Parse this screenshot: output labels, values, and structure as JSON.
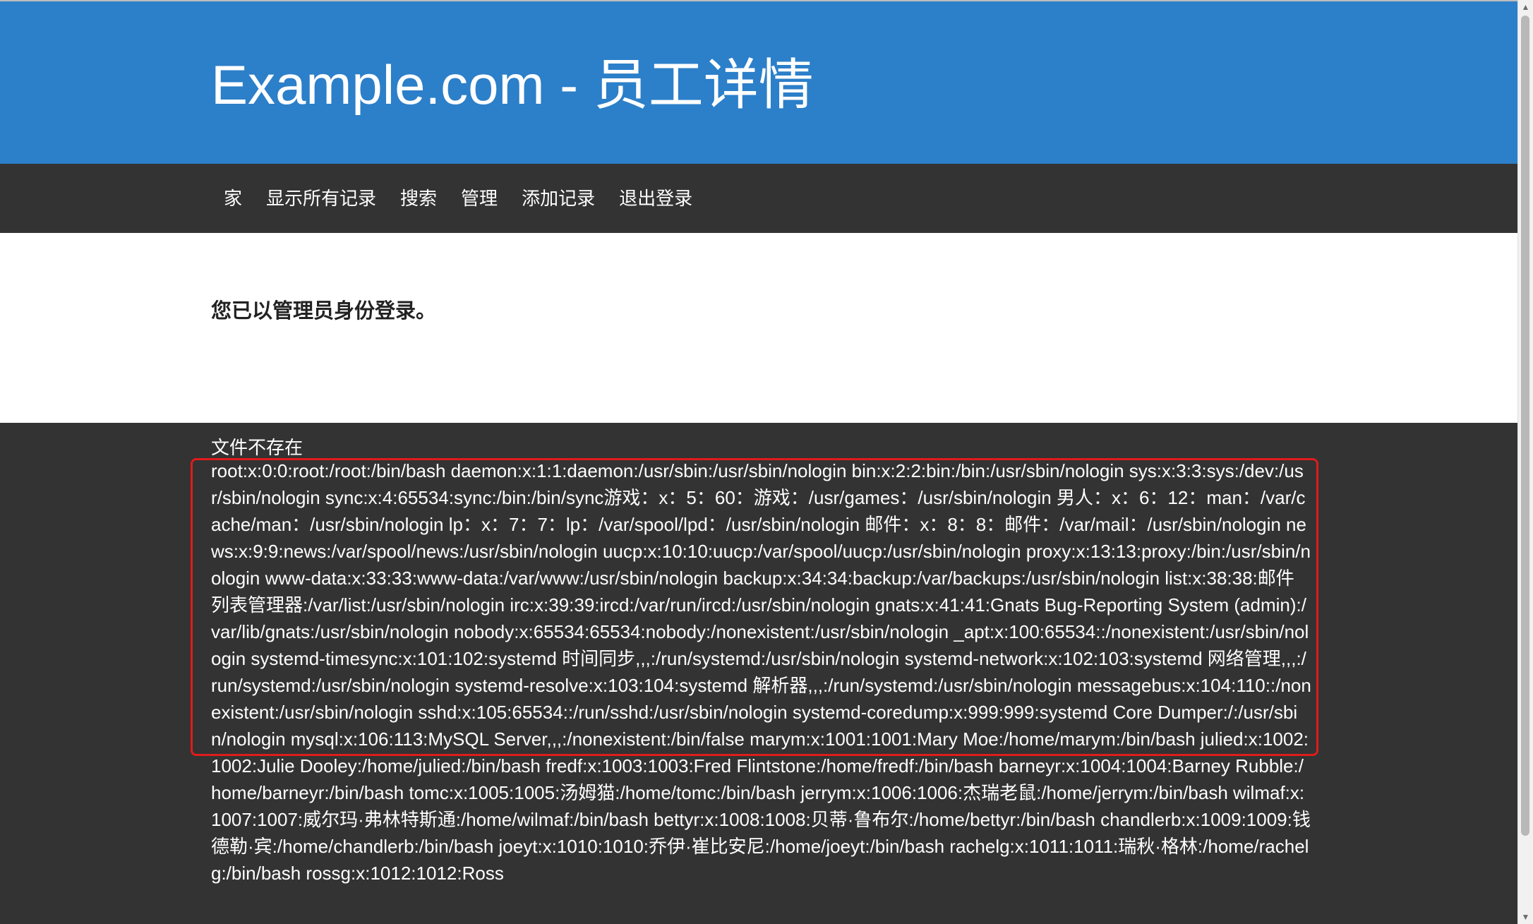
{
  "header": {
    "title": "Example.com - 员工详情"
  },
  "nav": {
    "items": [
      {
        "label": "家"
      },
      {
        "label": "显示所有记录"
      },
      {
        "label": "搜索"
      },
      {
        "label": "管理"
      },
      {
        "label": "添加记录"
      },
      {
        "label": "退出登录"
      }
    ]
  },
  "main": {
    "status_message": "您已以管理员身份登录。"
  },
  "footer": {
    "file_missing": "文件不存在",
    "file_output": "root:x:0:0:root:/root:/bin/bash daemon:x:1:1:daemon:/usr/sbin:/usr/sbin/nologin bin:x:2:2:bin:/bin:/usr/sbin/nologin sys:x:3:3:sys:/dev:/usr/sbin/nologin sync:x:4:65534:sync:/bin:/bin/sync游戏：x：5：60：游戏：/usr/games：/usr/sbin/nologin 男人：x：6：12：man：/var/cache/man：/usr/sbin/nologin lp：x：7：7：lp：/var/spool/lpd：/usr/sbin/nologin 邮件：x：8：8：邮件：/var/mail：/usr/sbin/nologin news:x:9:9:news:/var/spool/news:/usr/sbin/nologin uucp:x:10:10:uucp:/var/spool/uucp:/usr/sbin/nologin proxy:x:13:13:proxy:/bin:/usr/sbin/nologin www-data:x:33:33:www-data:/var/www:/usr/sbin/nologin backup:x:34:34:backup:/var/backups:/usr/sbin/nologin list:x:38:38:邮件列表管理器:/var/list:/usr/sbin/nologin irc:x:39:39:ircd:/var/run/ircd:/usr/sbin/nologin gnats:x:41:41:Gnats Bug-Reporting System (admin):/var/lib/gnats:/usr/sbin/nologin nobody:x:65534:65534:nobody:/nonexistent:/usr/sbin/nologin _apt:x:100:65534::/nonexistent:/usr/sbin/nologin systemd-timesync:x:101:102:systemd 时间同步,,,:/run/systemd:/usr/sbin/nologin systemd-network:x:102:103:systemd 网络管理,,,:/run/systemd:/usr/sbin/nologin systemd-resolve:x:103:104:systemd 解析器,,,:/run/systemd:/usr/sbin/nologin messagebus:x:104:110::/nonexistent:/usr/sbin/nologin sshd:x:105:65534::/run/sshd:/usr/sbin/nologin systemd-coredump:x:999:999:systemd Core Dumper:/:/usr/sbin/nologin mysql:x:106:113:MySQL Server,,,:/nonexistent:/bin/false marym:x:1001:1001:Mary Moe:/home/marym:/bin/bash julied:x:1002:1002:Julie Dooley:/home/julied:/bin/bash fredf:x:1003:1003:Fred Flintstone:/home/fredf:/bin/bash barneyr:x:1004:1004:Barney Rubble:/home/barneyr:/bin/bash tomc:x:1005:1005:汤姆猫:/home/tomc:/bin/bash jerrym:x:1006:1006:杰瑞老鼠:/home/jerrym:/bin/bash wilmaf:x:1007:1007:威尔玛·弗林特斯通:/home/wilmaf:/bin/bash bettyr:x:1008:1008:贝蒂·鲁布尔:/home/bettyr:/bin/bash chandlerb:x:1009:1009:钱德勒·宾:/home/chandlerb:/bin/bash joeyt:x:1010:1010:乔伊·崔比安尼:/home/joeyt:/bin/bash rachelg:x:1011:1011:瑞秋·格林:/home/rachelg:/bin/bash rossg:x:1012:1012:Ross"
  },
  "colors": {
    "header_bg": "#2c7fc9",
    "nav_bg": "#333333",
    "footer_bg": "#333333",
    "highlight_border": "#e01b1b"
  },
  "icons": {
    "scroll_up": "scroll-up-arrow-icon",
    "scroll_down": "scroll-down-arrow-icon"
  }
}
